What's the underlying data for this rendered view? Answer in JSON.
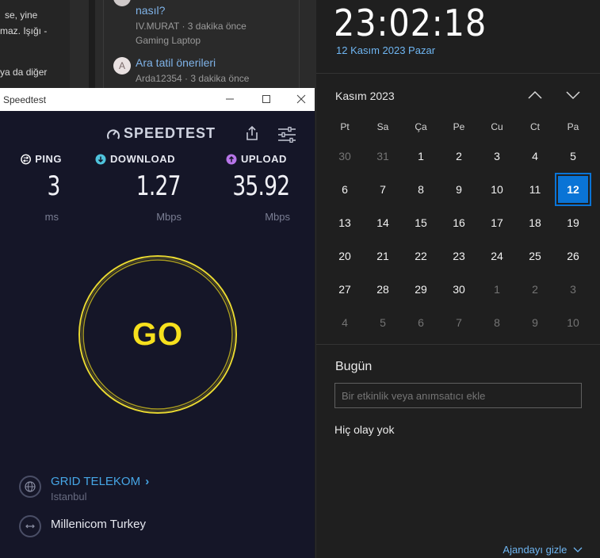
{
  "background": {
    "left_lines": [
      "se, yine",
      "maz. Işığı -",
      "ya da diğer"
    ],
    "posts": [
      {
        "title": "nasıl?",
        "author": "IV.MURAT",
        "time": "3 dakika önce",
        "subtitle": "Gaming Laptop"
      },
      {
        "avatar": "A",
        "title": "Ara tatil önerileri",
        "author": "Arda12354",
        "time": "3 dakika önce"
      }
    ]
  },
  "speedtest": {
    "window_title": "Speedtest",
    "window_buttons": {
      "minimize": "—",
      "maximize": "☐",
      "close": "✕"
    },
    "logo_text": "SPEEDTEST",
    "metrics": {
      "ping": {
        "label": "PING",
        "value": "3",
        "unit": "ms",
        "color": "#ffffff"
      },
      "download": {
        "label": "DOWNLOAD",
        "value": "1.27",
        "unit": "Mbps",
        "color": "#4fc3dc"
      },
      "upload": {
        "label": "UPLOAD",
        "value": "35.92",
        "unit": "Mbps",
        "color": "#b775e8"
      }
    },
    "go_label": "GO",
    "go_color": "#f6e01d",
    "server": {
      "provider": "GRID TELEKOM",
      "chevron": "›",
      "location": "Istanbul",
      "provider_color": "#46a6e6"
    },
    "isp": {
      "name": "Millenicom Turkey"
    }
  },
  "calendar": {
    "time": "23:02:18",
    "date": "12 Kasım 2023 Pazar",
    "month": "Kasım 2023",
    "weekdays": [
      "Pt",
      "Sa",
      "Ça",
      "Pe",
      "Cu",
      "Ct",
      "Pa"
    ],
    "weeks": [
      [
        {
          "d": "30",
          "cur": false
        },
        {
          "d": "31",
          "cur": false
        },
        {
          "d": "1",
          "cur": true
        },
        {
          "d": "2",
          "cur": true
        },
        {
          "d": "3",
          "cur": true
        },
        {
          "d": "4",
          "cur": true
        },
        {
          "d": "5",
          "cur": true
        }
      ],
      [
        {
          "d": "6",
          "cur": true
        },
        {
          "d": "7",
          "cur": true
        },
        {
          "d": "8",
          "cur": true
        },
        {
          "d": "9",
          "cur": true
        },
        {
          "d": "10",
          "cur": true
        },
        {
          "d": "11",
          "cur": true
        },
        {
          "d": "12",
          "cur": true,
          "today": true
        }
      ],
      [
        {
          "d": "13",
          "cur": true
        },
        {
          "d": "14",
          "cur": true
        },
        {
          "d": "15",
          "cur": true
        },
        {
          "d": "16",
          "cur": true
        },
        {
          "d": "17",
          "cur": true
        },
        {
          "d": "18",
          "cur": true
        },
        {
          "d": "19",
          "cur": true
        }
      ],
      [
        {
          "d": "20",
          "cur": true
        },
        {
          "d": "21",
          "cur": true
        },
        {
          "d": "22",
          "cur": true
        },
        {
          "d": "23",
          "cur": true
        },
        {
          "d": "24",
          "cur": true
        },
        {
          "d": "25",
          "cur": true
        },
        {
          "d": "26",
          "cur": true
        }
      ],
      [
        {
          "d": "27",
          "cur": true
        },
        {
          "d": "28",
          "cur": true
        },
        {
          "d": "29",
          "cur": true
        },
        {
          "d": "30",
          "cur": true
        },
        {
          "d": "1",
          "cur": false
        },
        {
          "d": "2",
          "cur": false
        },
        {
          "d": "3",
          "cur": false
        }
      ],
      [
        {
          "d": "4",
          "cur": false
        },
        {
          "d": "5",
          "cur": false
        },
        {
          "d": "6",
          "cur": false
        },
        {
          "d": "7",
          "cur": false
        },
        {
          "d": "8",
          "cur": false
        },
        {
          "d": "9",
          "cur": false
        },
        {
          "d": "10",
          "cur": false
        }
      ]
    ],
    "today_heading": "Bugün",
    "event_placeholder": "Bir etkinlik veya anımsatıcı ekle",
    "no_events": "Hiç olay yok",
    "hide_agenda": "Ajandayı gizle",
    "accent_color": "#0a74d6"
  }
}
